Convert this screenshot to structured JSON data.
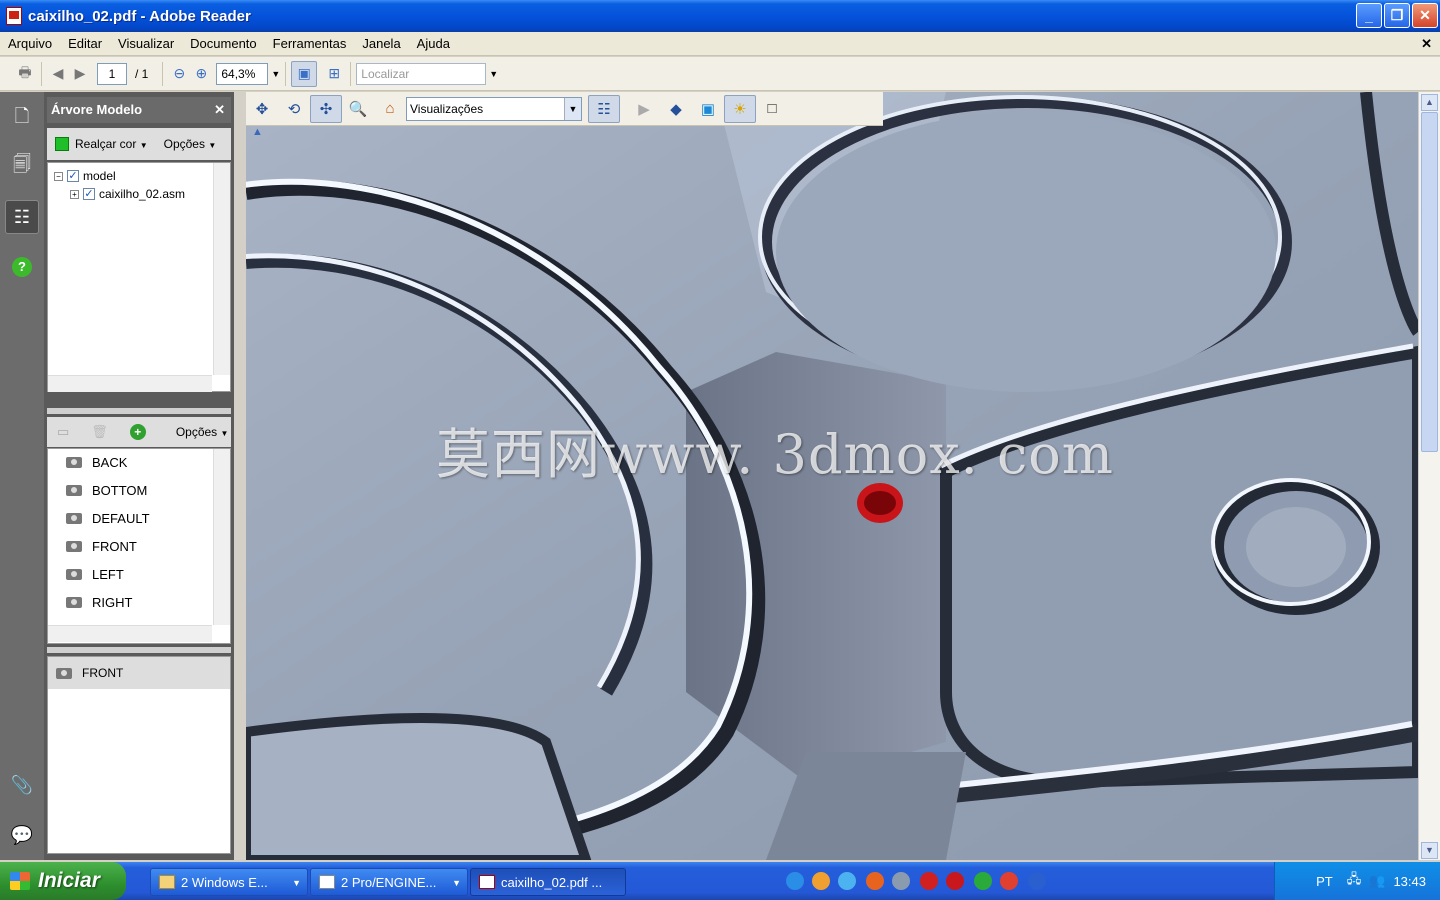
{
  "window": {
    "title": "caixilho_02.pdf - Adobe Reader"
  },
  "menu": [
    "Arquivo",
    "Editar",
    "Visualizar",
    "Documento",
    "Ferramentas",
    "Janela",
    "Ajuda"
  ],
  "toolbar": {
    "page_current": "1",
    "page_total": "/ 1",
    "zoom": "64,3%",
    "find_placeholder": "Localizar"
  },
  "panel": {
    "title": "Árvore Modelo",
    "highlight_label": "Realçar cor",
    "options_label": "Opções",
    "tree": [
      {
        "label": "model"
      },
      {
        "label": "caixilho_02.asm"
      }
    ],
    "views_options_label": "Opções",
    "views": [
      "BACK",
      "BOTTOM",
      "DEFAULT",
      "FRONT",
      "LEFT",
      "RIGHT"
    ],
    "current_view": "FRONT"
  },
  "viewer3d": {
    "views_dropdown": "Visualizações",
    "watermark": "莫西网www. 3dmox. com"
  },
  "taskbar": {
    "start": "Iniciar",
    "tasks": [
      {
        "label": "2 Windows E..."
      },
      {
        "label": "2 Pro/ENGINE..."
      },
      {
        "label": "caixilho_02.pdf ..."
      }
    ],
    "lang": "PT",
    "clock": "13:43"
  }
}
